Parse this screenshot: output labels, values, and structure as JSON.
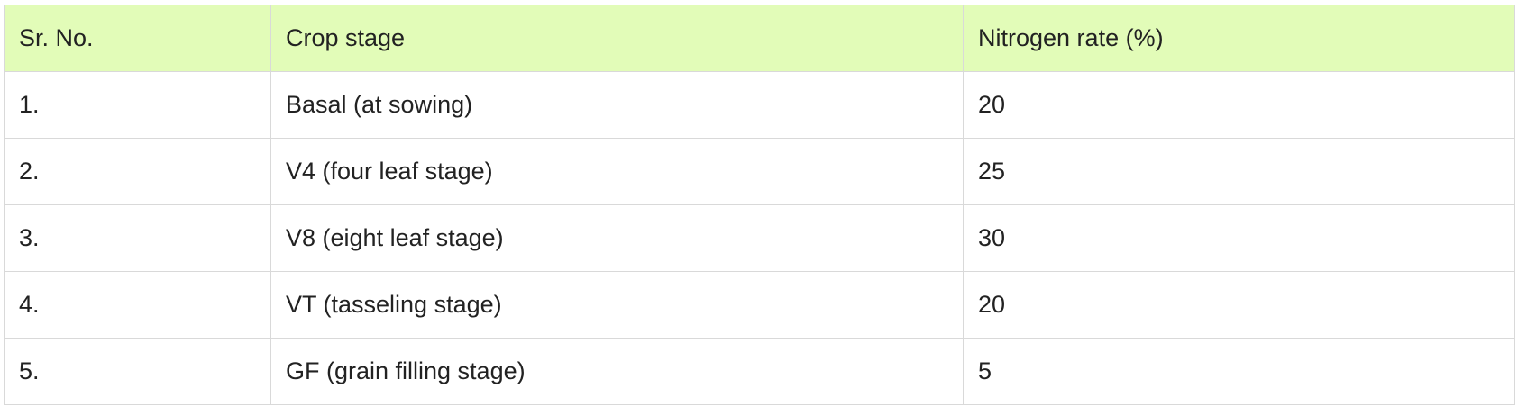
{
  "table": {
    "headers": [
      "Sr. No.",
      "Crop stage",
      "Nitrogen rate (%)"
    ],
    "rows": [
      [
        "1.",
        "Basal (at sowing)",
        "20"
      ],
      [
        "2.",
        "V4 (four leaf stage)",
        "25"
      ],
      [
        "3.",
        "V8 (eight leaf stage)",
        "30"
      ],
      [
        "4.",
        "VT (tasseling stage)",
        "20"
      ],
      [
        "5.",
        "GF (grain filling stage)",
        "5"
      ]
    ]
  },
  "colors": {
    "header_background": "#e2fcb8",
    "border": "#d9d9d9",
    "text": "#222222"
  }
}
